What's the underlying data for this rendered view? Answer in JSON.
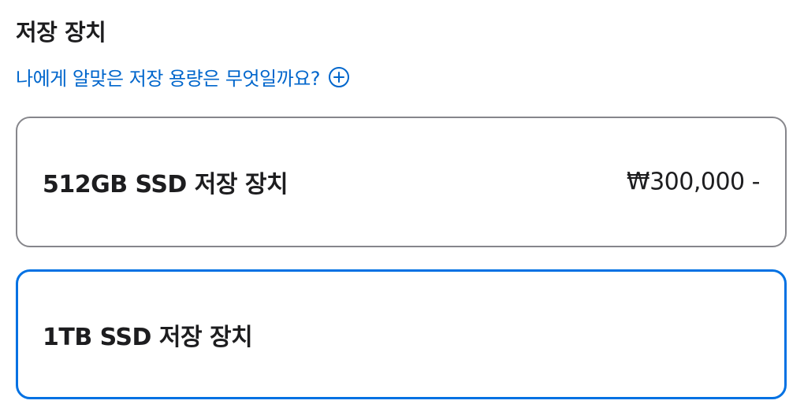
{
  "storage": {
    "title": "저장 장치",
    "help_link": "나에게 알맞은 저장 용량은 무엇일까요?",
    "help_icon": "plus-circle-icon",
    "options": [
      {
        "label": "512GB SSD 저장 장치",
        "price": "₩300,000 -",
        "selected": false
      },
      {
        "label": "1TB SSD 저장 장치",
        "price": "",
        "selected": true
      }
    ]
  },
  "colors": {
    "link": "#0066cc",
    "selected_border": "#0071e3",
    "default_border": "#86868b",
    "text": "#1d1d1f"
  }
}
